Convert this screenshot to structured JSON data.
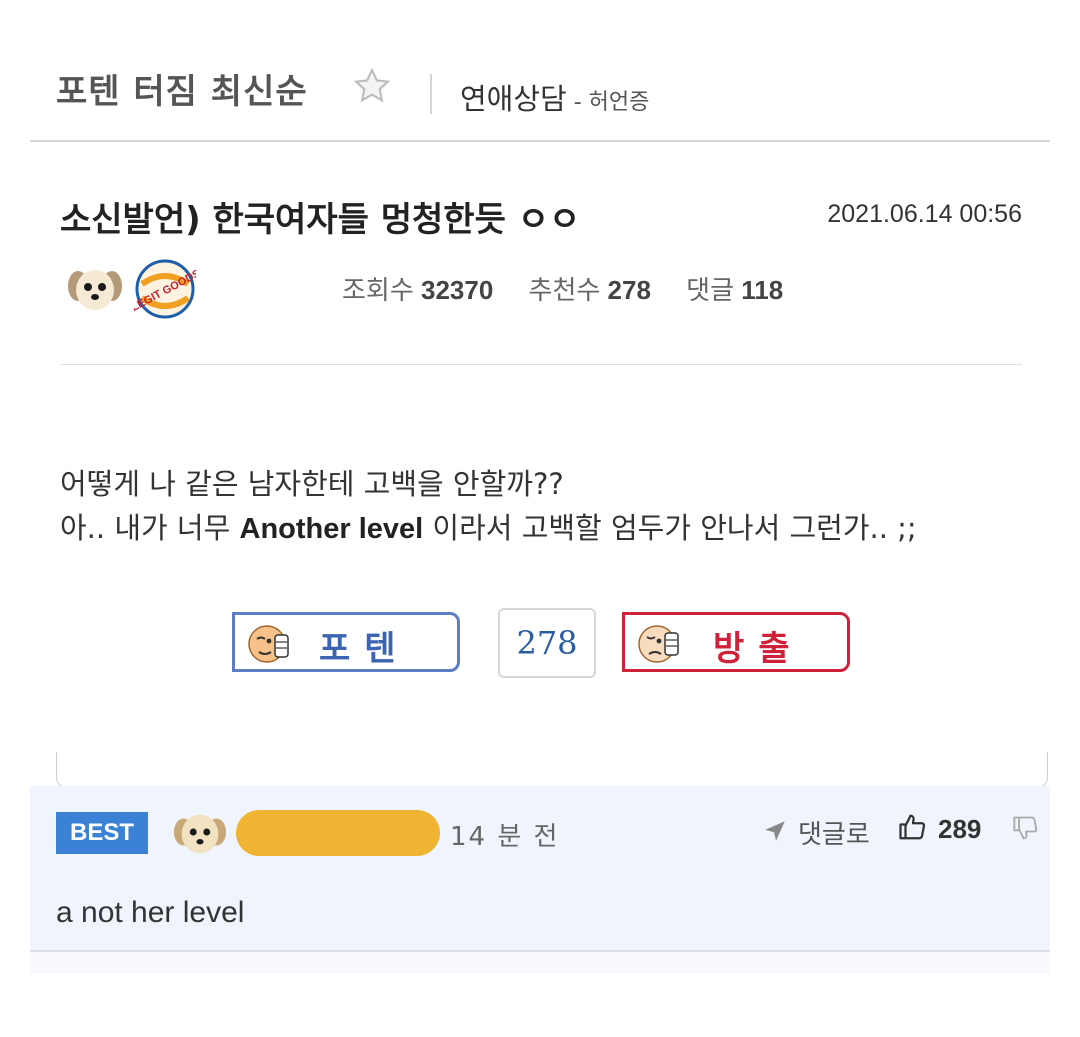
{
  "header": {
    "board_title": "포텐 터짐 최신순",
    "category": "연애상담",
    "category_sub": " - 허언증"
  },
  "post": {
    "title": "소신발언) 한국여자들 멍청한듯 ㅇㅇ",
    "date": "2021.06.14 00:56",
    "badge_text": "LEGIT GOODS",
    "stats": {
      "views_label": "조회수",
      "views": "32370",
      "recommends_label": "추천수",
      "recommends": "278",
      "comments_label": "댓글",
      "comments": "118"
    },
    "body": {
      "line1": "어떻게 나 같은 남자한테 고백을 안할까??",
      "line2_prefix": "아.. 내가 너무 ",
      "line2_bold": "Another level",
      "line2_suffix": " 이라서 고백할 엄두가 안나서 그런가.. ;;"
    },
    "vote": {
      "up_label": "포텐",
      "count": "278",
      "down_label": "방출"
    }
  },
  "comment": {
    "badge": "BEST",
    "time": "14 분 전",
    "reply_label": "댓글로",
    "likes": "289",
    "text": "a not her level"
  },
  "colors": {
    "best_badge": "#3b82d6",
    "vote_up": "#3d64b3",
    "vote_down": "#d0213a",
    "comment_bg": "#f0f5fd",
    "redaction": "#f0b433"
  }
}
